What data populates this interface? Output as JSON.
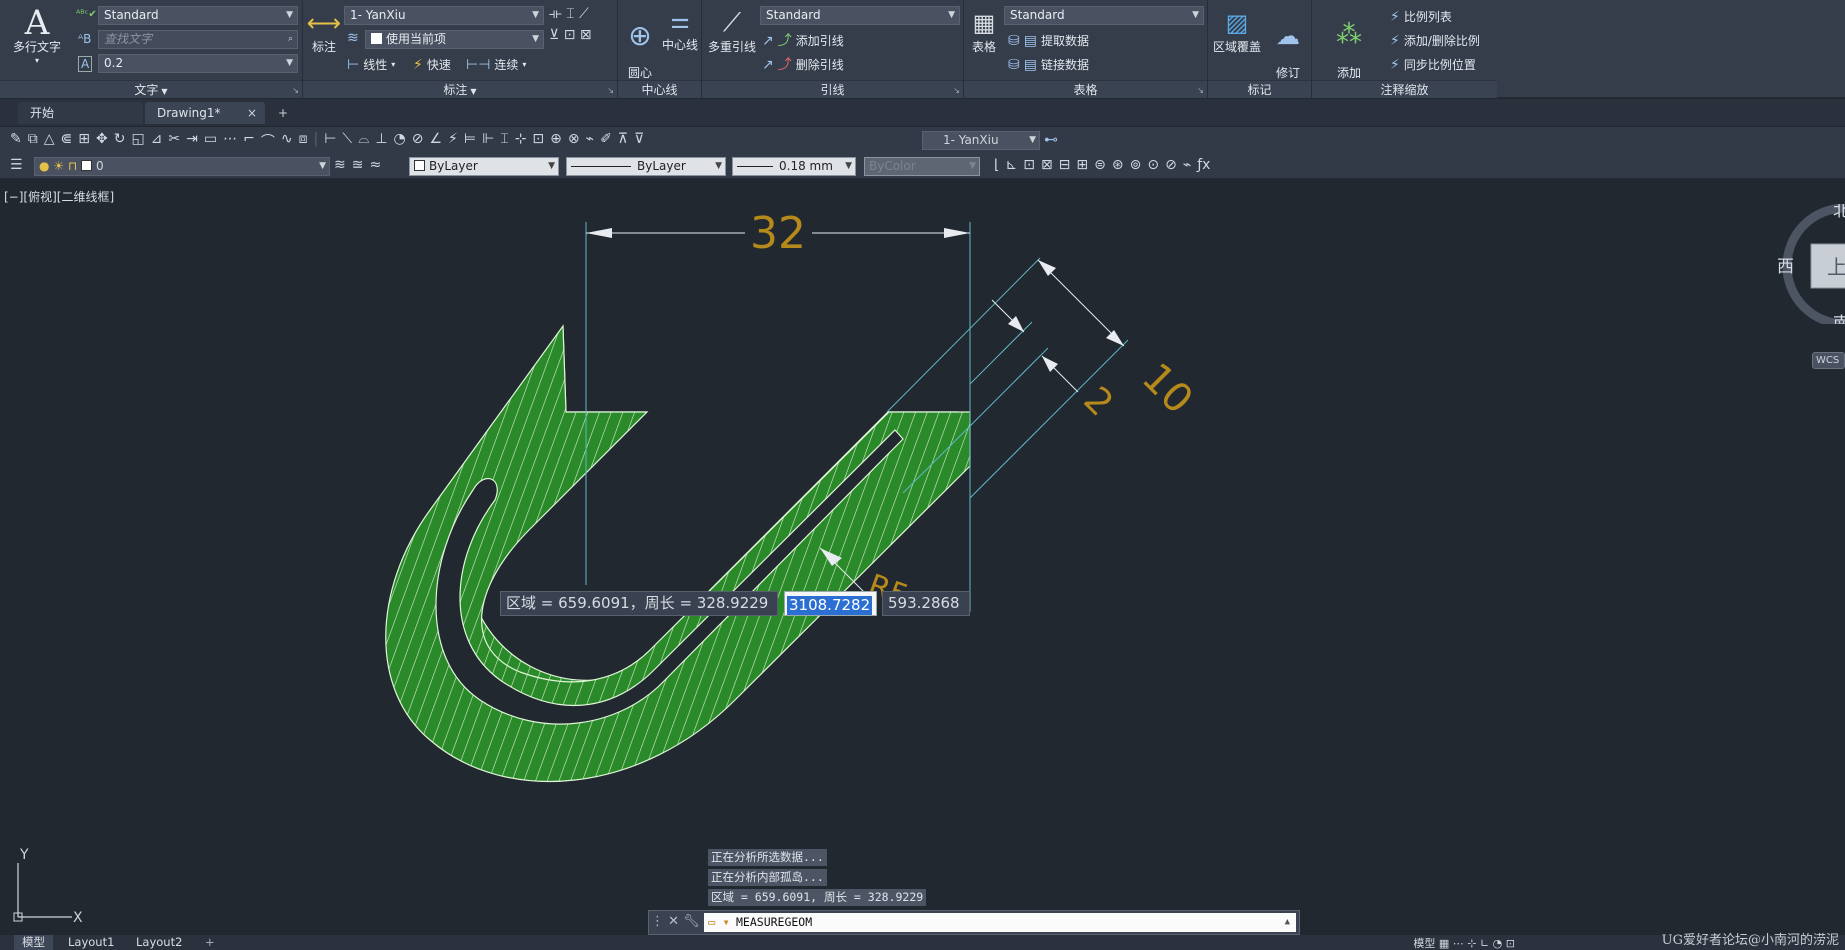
{
  "ribbon": {
    "text_panel": {
      "title": "文字",
      "mtext_label": "多行文字",
      "style_value": "Standard",
      "find_placeholder": "查找文字",
      "height_value": "0.2"
    },
    "dim_panel": {
      "title": "标注",
      "dim_label": "标注",
      "dimstyle_value": "1- YanXiu",
      "layer_value": "使用当前项",
      "linear_label": "线性",
      "quick_label": "快速",
      "continue_label": "连续"
    },
    "centerline_panel": {
      "title": "中心线",
      "center_mark_label": "圆心\n标记",
      "centerline_label": "中心线"
    },
    "leader_panel": {
      "title": "引线",
      "mleader_label": "多重引线",
      "mleader_style_value": "Standard",
      "add_leader_label": "添加引线",
      "remove_leader_label": "删除引线"
    },
    "table_panel": {
      "title": "表格",
      "table_label": "表格",
      "table_style_value": "Standard",
      "extract_label": "提取数据",
      "link_label": "链接数据"
    },
    "markup_panel": {
      "title": "标记",
      "wipeout_label": "区域覆盖",
      "revcloud_label": "修订\n云线"
    },
    "scale_panel": {
      "title": "注释缩放",
      "add_scale_label": "添加\n当前比例",
      "scale_list_label": "比例列表",
      "add_remove_label": "添加/删除比例",
      "sync_label": "同步比例位置"
    }
  },
  "tabs": {
    "start": "开始",
    "drawing": "Drawing1*",
    "close": "×",
    "add": "+"
  },
  "toolbar": {
    "dimstyle_value": "1- YanXiu",
    "layer_value": "0",
    "color_value": "ByLayer",
    "linetype_value": "ByLayer",
    "lineweight_value": "0.18 mm",
    "plotstyle_value": "ByColor"
  },
  "viewport": {
    "label": "[−][俯视][二维线框]",
    "compass": {
      "north": "北",
      "west": "西",
      "south": "南",
      "top": "上",
      "wcs": "WCS"
    },
    "ucs": {
      "x": "X",
      "y": "Y"
    }
  },
  "drawing": {
    "dim_width": "32",
    "dim_thickness": "10",
    "dim_gap": "2",
    "dim_hidden": "R5",
    "hatch_color": "#2a8a2a",
    "hatch_line_color": "#cfe8c6",
    "dim_color": "#b58a1a",
    "extension_color": "#5fb7c4"
  },
  "dynamic_input": {
    "area_text": "区域 = 659.6091，周长 = 328.9229",
    "value_selected": "3108.7282",
    "second_value": "593.2868"
  },
  "command_history": [
    "正在分析所选数据...",
    "正在分析内部孤岛...",
    "区域 = 659.6091, 周长 = 328.9229"
  ],
  "command_line": {
    "value": "MEASUREGEOM"
  },
  "layout_tabs": {
    "model": "模型",
    "layout1": "Layout1",
    "layout2": "Layout2",
    "add": "+"
  },
  "status_bar": {
    "model_label": "模型",
    "watermark": "UG爱好者论坛@小南河的涝泥"
  },
  "colors": {
    "background": "#212830",
    "ribbon": "#353d4b",
    "accent_selection": "#2a6fd1"
  }
}
